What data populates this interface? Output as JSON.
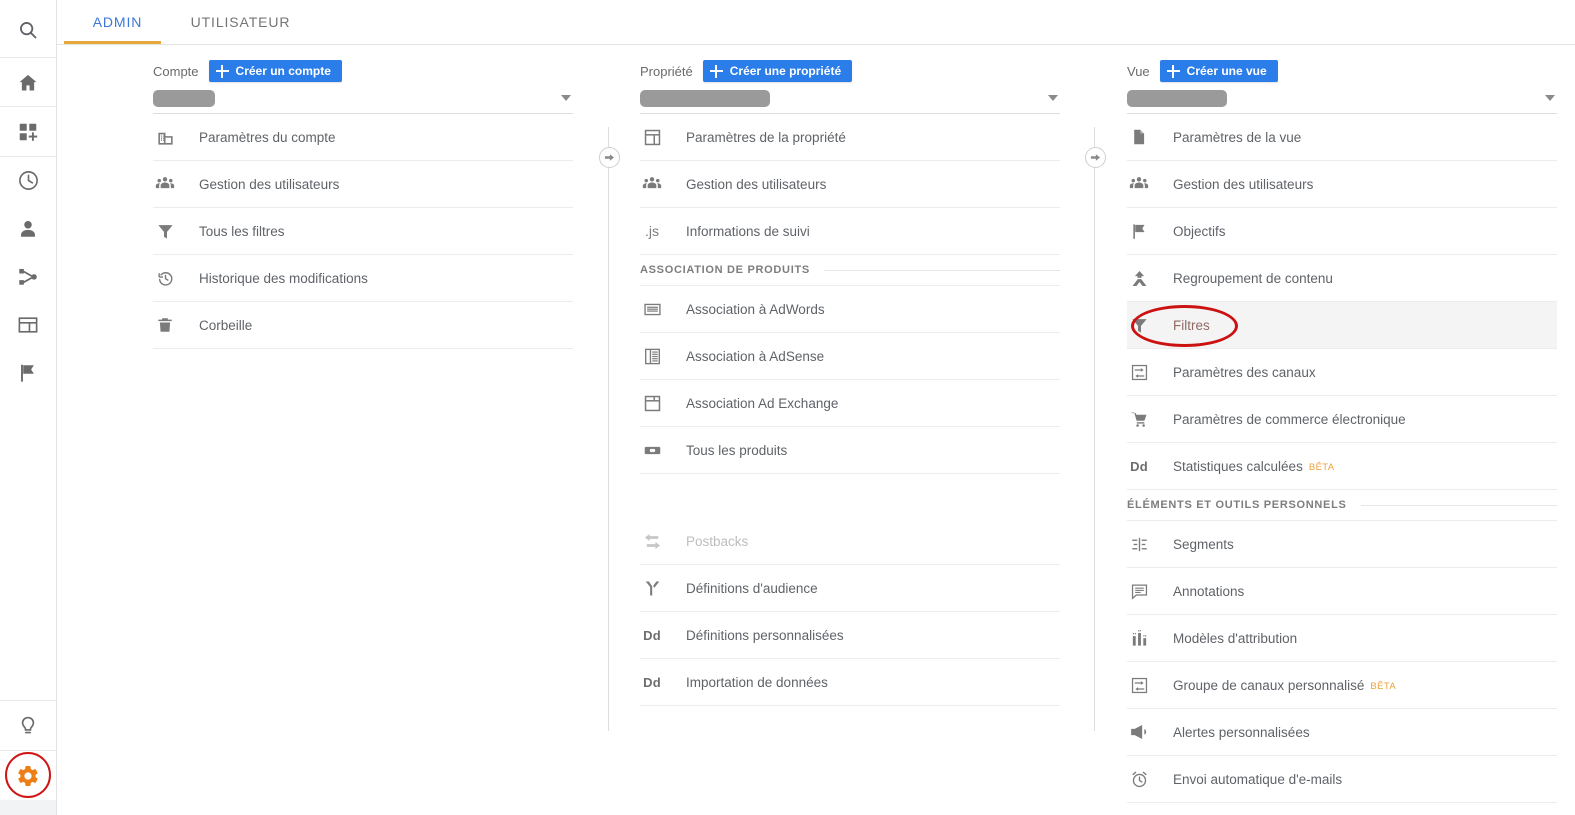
{
  "app": {
    "tabs": [
      {
        "label": "ADMIN",
        "active": true
      },
      {
        "label": "UTILISATEUR",
        "active": false
      }
    ],
    "accent_blue": "#2b7de9",
    "tab_underline_color": "#e5a93b",
    "annotation_color": "#cc1111",
    "gear_color": "#ee7e17",
    "beta_color": "#e8a33d"
  },
  "rail": {
    "items": [
      {
        "name": "search-icon",
        "label": "Rechercher"
      },
      {
        "name": "home-icon",
        "label": "Accueil"
      },
      {
        "name": "customization-icon",
        "label": "Personnalisation"
      },
      {
        "name": "realtime-clock-icon",
        "label": "Temps réel"
      },
      {
        "name": "audience-person-icon",
        "label": "Audience"
      },
      {
        "name": "acquisition-node-icon",
        "label": "Acquisition"
      },
      {
        "name": "behavior-window-icon",
        "label": "Comportement"
      },
      {
        "name": "conversions-flag-icon",
        "label": "Conversions"
      },
      {
        "name": "discover-bulb-icon",
        "label": "Découvrir"
      },
      {
        "name": "admin-gear-icon",
        "label": "Administration"
      }
    ]
  },
  "columns": [
    {
      "key": "account",
      "head_label": "Compte",
      "create_label": "Créer un compte",
      "selector_placeholder": "",
      "items": [
        {
          "type": "item",
          "icon": "building-icon",
          "label": "Paramètres du compte"
        },
        {
          "type": "item",
          "icon": "users-group-icon",
          "label": "Gestion des utilisateurs"
        },
        {
          "type": "item",
          "icon": "filter-funnel-icon",
          "label": "Tous les filtres"
        },
        {
          "type": "item",
          "icon": "history-clock-icon",
          "label": "Historique des modifications"
        },
        {
          "type": "item",
          "icon": "trash-icon",
          "label": "Corbeille"
        }
      ]
    },
    {
      "key": "property",
      "head_label": "Propriété",
      "create_label": "Créer une propriété",
      "selector_placeholder": "",
      "items": [
        {
          "type": "item",
          "icon": "property-window-icon",
          "label": "Paramètres de la propriété"
        },
        {
          "type": "item",
          "icon": "users-group-icon",
          "label": "Gestion des utilisateurs"
        },
        {
          "type": "item",
          "icon": "js-text-icon",
          "label": "Informations de suivi"
        },
        {
          "type": "section",
          "label": "ASSOCIATION DE PRODUITS"
        },
        {
          "type": "item",
          "icon": "adwords-card-icon",
          "label": "Association à AdWords"
        },
        {
          "type": "item",
          "icon": "adsense-list-icon",
          "label": "Association à AdSense"
        },
        {
          "type": "item",
          "icon": "ad-exchange-icon",
          "label": "Association Ad Exchange"
        },
        {
          "type": "item",
          "icon": "link-chain-icon",
          "label": "Tous les produits"
        },
        {
          "type": "spacer"
        },
        {
          "type": "item",
          "icon": "postbacks-arrows-icon",
          "label": "Postbacks",
          "dim": true
        },
        {
          "type": "item",
          "icon": "audience-branch-icon",
          "label": "Définitions d'audience"
        },
        {
          "type": "item",
          "icon": "dd-text-icon",
          "label": "Définitions personnalisées"
        },
        {
          "type": "item",
          "icon": "dd-text-icon",
          "label": "Importation de données"
        }
      ]
    },
    {
      "key": "view",
      "head_label": "Vue",
      "create_label": "Créer une vue",
      "selector_placeholder": "",
      "items": [
        {
          "type": "item",
          "icon": "document-icon",
          "label": "Paramètres de la vue"
        },
        {
          "type": "item",
          "icon": "users-group-icon",
          "label": "Gestion des utilisateurs"
        },
        {
          "type": "item",
          "icon": "goal-flag-icon",
          "label": "Objectifs"
        },
        {
          "type": "item",
          "icon": "content-grouping-icon",
          "label": "Regroupement de contenu"
        },
        {
          "type": "item",
          "icon": "filter-funnel-icon",
          "label": "Filtres",
          "selected": true,
          "annotated": true
        },
        {
          "type": "item",
          "icon": "channel-arrows-icon",
          "label": "Paramètres des canaux"
        },
        {
          "type": "item",
          "icon": "cart-icon",
          "label": "Paramètres de commerce électronique"
        },
        {
          "type": "item",
          "icon": "dd-text-icon",
          "label": "Statistiques calculées",
          "badge": "BÊTA"
        },
        {
          "type": "section",
          "label": "ÉLÉMENTS ET OUTILS PERSONNELS"
        },
        {
          "type": "item",
          "icon": "segments-icon",
          "label": "Segments"
        },
        {
          "type": "item",
          "icon": "annotations-icon",
          "label": "Annotations"
        },
        {
          "type": "item",
          "icon": "attribution-bars-icon",
          "label": "Modèles d'attribution"
        },
        {
          "type": "item",
          "icon": "channel-arrows-icon",
          "label": "Groupe de canaux personnalisé",
          "badge": "BÊTA"
        },
        {
          "type": "item",
          "icon": "megaphone-icon",
          "label": "Alertes personnalisées"
        },
        {
          "type": "item",
          "icon": "alarm-clock-icon",
          "label": "Envoi automatique d'e-mails"
        }
      ]
    }
  ]
}
